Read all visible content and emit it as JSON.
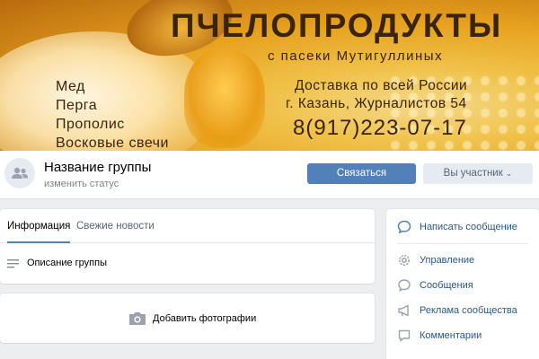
{
  "banner": {
    "title": "ПЧЕЛОПРОДУКТЫ",
    "subtitle": "с пасеки Мутигуллиных",
    "products": [
      "Мед",
      "Перга",
      "Прополис",
      "Восковые свечи"
    ],
    "delivery": "Доставка по всей России",
    "address": "г. Казань, Журналистов 54",
    "phone": "8(917)223-07-17"
  },
  "header": {
    "group_name": "Название группы",
    "status": "изменить статус",
    "contact_button": "Связаться",
    "member_button": "Вы участник"
  },
  "info": {
    "tabs": [
      "Информация",
      "Свежие новости"
    ],
    "description": "Описание группы"
  },
  "photos": {
    "add_label": "Добавить фотографии"
  },
  "sidebar": {
    "items": [
      {
        "label": "Написать сообщение",
        "icon": "message-icon"
      },
      {
        "label": "Управление",
        "icon": "gear-icon"
      },
      {
        "label": "Сообщения",
        "icon": "chat-icon"
      },
      {
        "label": "Реклама сообщества",
        "icon": "megaphone-icon"
      },
      {
        "label": "Комментарии",
        "icon": "comment-icon"
      }
    ]
  },
  "colors": {
    "accent": "#5181b8",
    "link": "#2a5885",
    "page_bg": "#edeef0"
  }
}
